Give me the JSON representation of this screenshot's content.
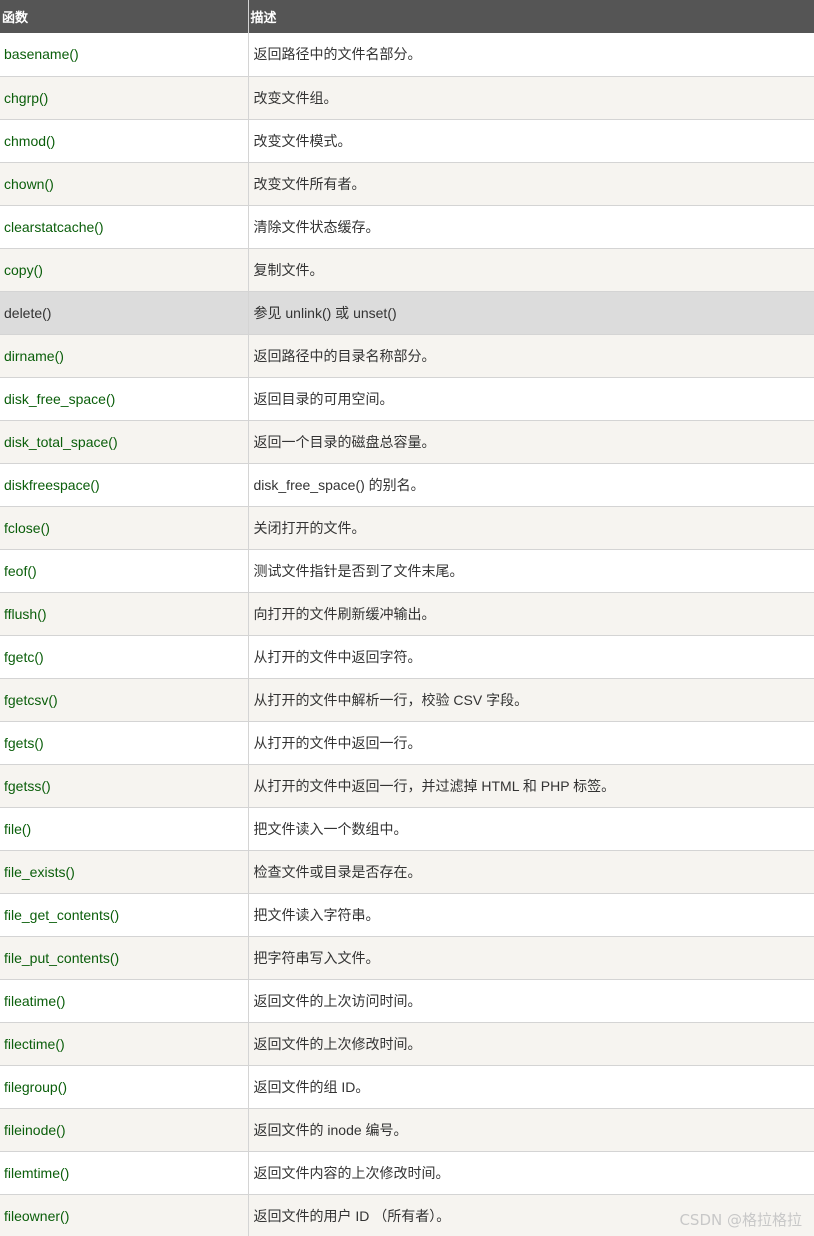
{
  "header": {
    "col_function": "函数",
    "col_description": "描述"
  },
  "rows": [
    {
      "fn": "basename()",
      "desc": "返回路径中的文件名部分。"
    },
    {
      "fn": "chgrp()",
      "desc": "改变文件组。"
    },
    {
      "fn": "chmod()",
      "desc": "改变文件模式。"
    },
    {
      "fn": "chown()",
      "desc": "改变文件所有者。"
    },
    {
      "fn": "clearstatcache()",
      "desc": "清除文件状态缓存。"
    },
    {
      "fn": "copy()",
      "desc": "复制文件。"
    },
    {
      "fn": "delete()",
      "desc": "参见 unlink() 或 unset()"
    },
    {
      "fn": "dirname()",
      "desc": "返回路径中的目录名称部分。"
    },
    {
      "fn": "disk_free_space()",
      "desc": "返回目录的可用空间。"
    },
    {
      "fn": "disk_total_space()",
      "desc": "返回一个目录的磁盘总容量。"
    },
    {
      "fn": "diskfreespace()",
      "desc": "disk_free_space() 的别名。"
    },
    {
      "fn": "fclose()",
      "desc": "关闭打开的文件。"
    },
    {
      "fn": "feof()",
      "desc": "测试文件指针是否到了文件末尾。"
    },
    {
      "fn": "fflush()",
      "desc": "向打开的文件刷新缓冲输出。"
    },
    {
      "fn": "fgetc()",
      "desc": "从打开的文件中返回字符。"
    },
    {
      "fn": "fgetcsv()",
      "desc": "从打开的文件中解析一行，校验 CSV 字段。"
    },
    {
      "fn": "fgets()",
      "desc": "从打开的文件中返回一行。"
    },
    {
      "fn": "fgetss()",
      "desc": "从打开的文件中返回一行，并过滤掉 HTML 和 PHP 标签。"
    },
    {
      "fn": "file()",
      "desc": "把文件读入一个数组中。"
    },
    {
      "fn": "file_exists()",
      "desc": "检查文件或目录是否存在。"
    },
    {
      "fn": "file_get_contents()",
      "desc": "把文件读入字符串。"
    },
    {
      "fn": "file_put_contents()",
      "desc": "把字符串写入文件。"
    },
    {
      "fn": "fileatime()",
      "desc": "返回文件的上次访问时间。"
    },
    {
      "fn": "filectime()",
      "desc": "返回文件的上次修改时间。"
    },
    {
      "fn": "filegroup()",
      "desc": "返回文件的组 ID。"
    },
    {
      "fn": "fileinode()",
      "desc": "返回文件的 inode 编号。"
    },
    {
      "fn": "filemtime()",
      "desc": "返回文件内容的上次修改时间。"
    },
    {
      "fn": "fileowner()",
      "desc": "返回文件的用户 ID （所有者）。"
    }
  ],
  "highlighted_row": 6,
  "watermark": "CSDN @格拉格拉",
  "colors": {
    "header_bg": "#555555",
    "link": "#0a5e0a",
    "alt_row": "#f6f4f0",
    "highlight_row": "#dcdcdc"
  }
}
